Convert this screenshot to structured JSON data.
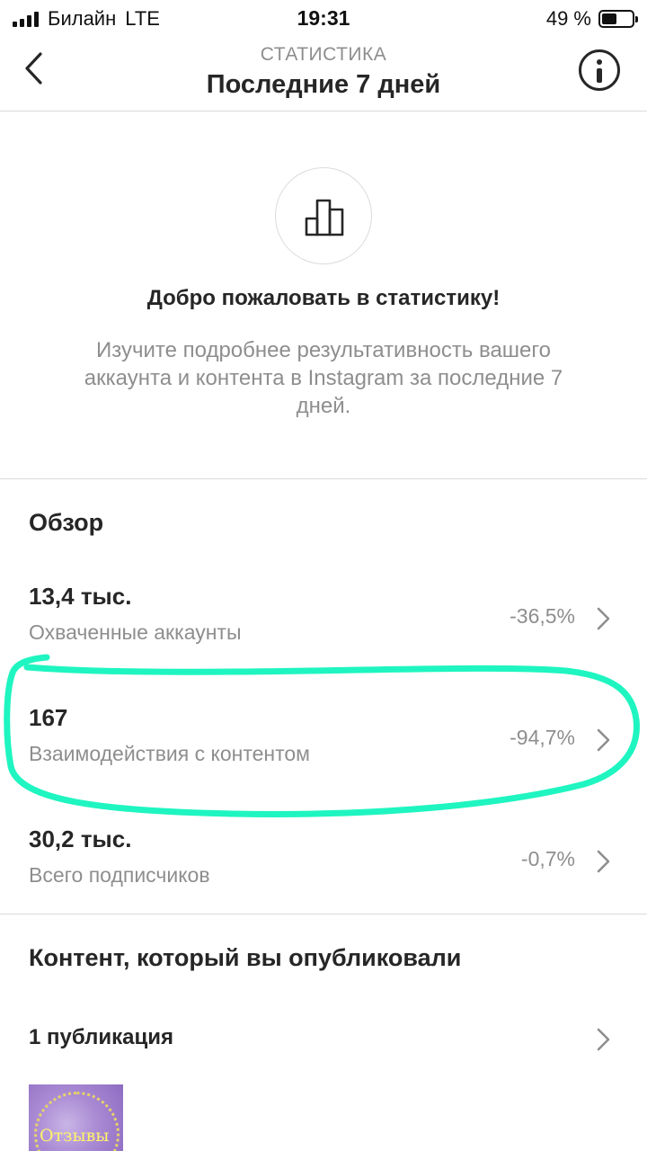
{
  "status_bar": {
    "carrier": "Билайн",
    "network": "LTE",
    "time": "19:31",
    "battery_percent": "49 %",
    "battery_level": 0.49
  },
  "header": {
    "subtitle": "СТАТИСТИКА",
    "title": "Последние 7 дней",
    "back_icon": "chevron-left-icon",
    "info_icon": "info-icon"
  },
  "welcome": {
    "icon": "bar-chart-icon",
    "title": "Добро пожаловать в статистику!",
    "text": "Изучите подробнее результативность вашего аккаунта и контента в Instagram за последние 7 дней."
  },
  "overview": {
    "title": "Обзор",
    "metrics": [
      {
        "value": "13,4 тыс.",
        "label": "Охваченные аккаунты",
        "change": "-36,5%"
      },
      {
        "value": "167",
        "label": "Взаимодействия с контентом",
        "change": "-94,7%"
      },
      {
        "value": "30,2 тыс.",
        "label": "Всего подписчиков",
        "change": "-0,7%"
      }
    ]
  },
  "content": {
    "title": "Контент, который вы опубликовали",
    "publications_label": "1 публикация",
    "thumbnail_text": "Отзывы"
  },
  "colors": {
    "highlight": "#1ff5c0",
    "text_primary": "#262626",
    "text_secondary": "#8e8e8e",
    "divider": "#dbdbdb"
  }
}
